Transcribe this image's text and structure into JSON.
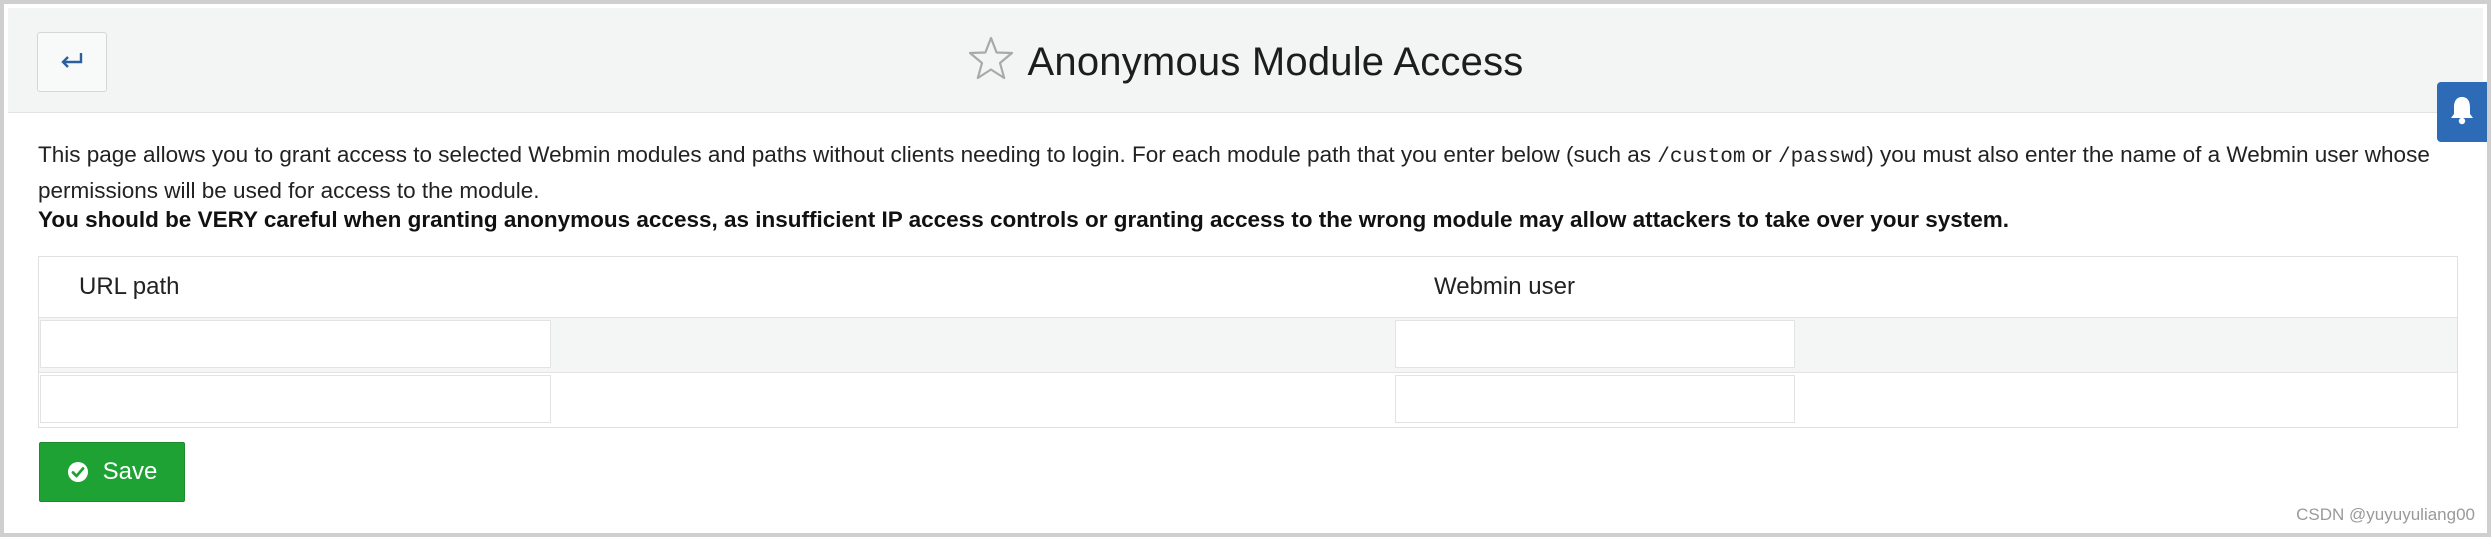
{
  "header": {
    "back_icon": "return-arrow-icon",
    "star_icon": "star-outline-icon",
    "title": "Anonymous Module Access",
    "notification_icon": "bell-icon"
  },
  "description": {
    "part1": "This page allows you to grant access to selected Webmin modules and paths without clients needing to login. For each module path that you enter below (such as ",
    "code1": "/custom",
    "part2": " or ",
    "code2": "/passwd",
    "part3": ") you must also enter the name of a Webmin user whose permissions will be used for access to the module."
  },
  "warning": "You should be VERY careful when granting anonymous access, as insufficient IP access controls or granting access to the wrong module may allow attackers to take over your system.",
  "table": {
    "col_url_path": "URL path",
    "col_webmin_user": "Webmin user",
    "rows": [
      {
        "url_path": "",
        "webmin_user": ""
      },
      {
        "url_path": "",
        "webmin_user": ""
      }
    ]
  },
  "save_button": {
    "label": "Save",
    "icon": "check-circle-icon"
  },
  "watermark": "CSDN @yuyuyuliang00",
  "colors": {
    "header_bg": "#f3f4f4",
    "save_green": "#1fa234",
    "bell_blue": "#2d6bb6",
    "back_arrow": "#2b5f9e"
  }
}
